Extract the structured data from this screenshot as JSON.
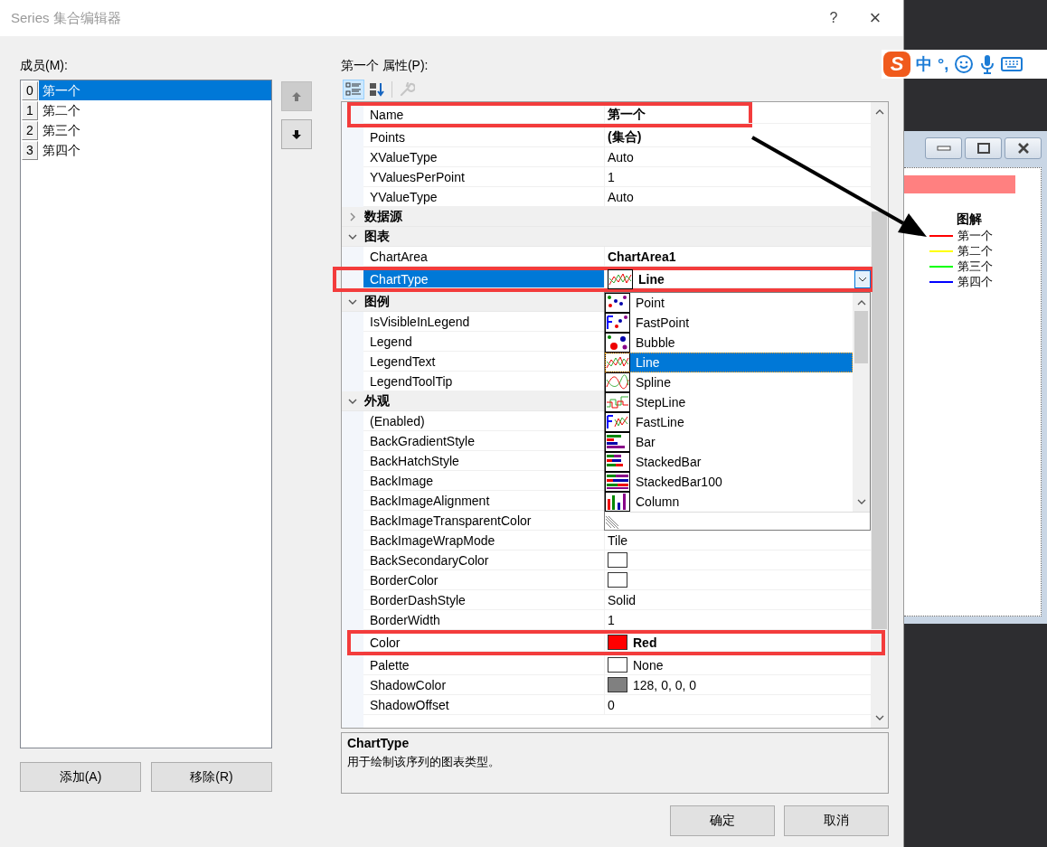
{
  "window": {
    "title": "Series 集合编辑器",
    "help": "?",
    "close": "×"
  },
  "members": {
    "label": "成员(M):",
    "items": [
      {
        "index": "0",
        "name": "第一个",
        "selected": true
      },
      {
        "index": "1",
        "name": "第二个",
        "selected": false
      },
      {
        "index": "2",
        "name": "第三个",
        "selected": false
      },
      {
        "index": "3",
        "name": "第四个",
        "selected": false
      }
    ]
  },
  "move_buttons": [
    {
      "kind": "up",
      "disabled": true
    },
    {
      "kind": "down",
      "disabled": false
    }
  ],
  "member_buttons": [
    "添加(A)",
    "移除(R)"
  ],
  "properties": {
    "label": "第一个 属性(P):",
    "view_buttons": [
      {
        "kind": "categorized",
        "selected": true
      },
      {
        "kind": "alphabetical",
        "selected": false
      }
    ],
    "pages_button": {
      "disabled": true
    },
    "rows": [
      {
        "kind": "property",
        "name": "Name",
        "value": "第一个",
        "modified": true,
        "selected": false,
        "annotated": true
      },
      {
        "kind": "property",
        "name": "Points",
        "value": "(集合)",
        "modified": true,
        "selected": false,
        "annotated": false
      },
      {
        "kind": "property",
        "name": "XValueType",
        "value": "Auto",
        "modified": false,
        "selected": false,
        "annotated": false
      },
      {
        "kind": "property",
        "name": "YValuesPerPoint",
        "value": "1",
        "modified": false,
        "selected": false,
        "annotated": false
      },
      {
        "kind": "property",
        "name": "YValueType",
        "value": "Auto",
        "modified": false,
        "selected": false,
        "annotated": false
      },
      {
        "kind": "category",
        "label": "数据源",
        "expanded": false
      },
      {
        "kind": "category",
        "label": "图表",
        "expanded": true
      },
      {
        "kind": "property",
        "name": "ChartArea",
        "value": "ChartArea1",
        "modified": true,
        "selected": false,
        "annotated": false
      },
      {
        "kind": "property",
        "name": "ChartType",
        "value": "Line",
        "modified": true,
        "selected": true,
        "annotated": true,
        "dropdown": {
          "items": [
            {
              "label": "Point",
              "kind": "point",
              "selected": false
            },
            {
              "label": "FastPoint",
              "kind": "fastpoint",
              "selected": false
            },
            {
              "label": "Bubble",
              "kind": "bubble",
              "selected": false
            },
            {
              "label": "Line",
              "kind": "line",
              "selected": true
            },
            {
              "label": "Spline",
              "kind": "spline",
              "selected": false
            },
            {
              "label": "StepLine",
              "kind": "stepline",
              "selected": false
            },
            {
              "label": "FastLine",
              "kind": "fastline",
              "selected": false
            },
            {
              "label": "Bar",
              "kind": "bar",
              "selected": false
            },
            {
              "label": "StackedBar",
              "kind": "stackedbar",
              "selected": false
            },
            {
              "label": "StackedBar100",
              "kind": "stackedbar100",
              "selected": false
            },
            {
              "label": "Column",
              "kind": "column",
              "selected": false
            }
          ]
        }
      },
      {
        "kind": "category",
        "label": "图例",
        "expanded": true
      },
      {
        "kind": "property",
        "name": "IsVisibleInLegend",
        "selected": false,
        "annotated": false
      },
      {
        "kind": "property",
        "name": "Legend",
        "selected": false,
        "annotated": false
      },
      {
        "kind": "property",
        "name": "LegendText",
        "selected": false,
        "annotated": false
      },
      {
        "kind": "property",
        "name": "LegendToolTip",
        "selected": false,
        "annotated": false
      },
      {
        "kind": "category",
        "label": "外观",
        "expanded": true
      },
      {
        "kind": "property",
        "name": "(Enabled)",
        "selected": false,
        "annotated": false
      },
      {
        "kind": "property",
        "name": "BackGradientStyle",
        "selected": false,
        "annotated": false
      },
      {
        "kind": "property",
        "name": "BackHatchStyle",
        "selected": false,
        "annotated": false
      },
      {
        "kind": "property",
        "name": "BackImage",
        "selected": false,
        "annotated": false
      },
      {
        "kind": "property",
        "name": "BackImageAlignment",
        "selected": false,
        "annotated": false
      },
      {
        "kind": "property",
        "name": "BackImageTransparentColor",
        "selected": false,
        "annotated": false
      },
      {
        "kind": "property",
        "name": "BackImageWrapMode",
        "value": "Tile",
        "modified": false,
        "selected": false,
        "annotated": false
      },
      {
        "kind": "property",
        "name": "BackSecondaryColor",
        "color": "#ffffff",
        "selected": false,
        "annotated": false
      },
      {
        "kind": "property",
        "name": "BorderColor",
        "color": "#ffffff",
        "selected": false,
        "annotated": false
      },
      {
        "kind": "property",
        "name": "BorderDashStyle",
        "value": "Solid",
        "modified": false,
        "selected": false,
        "annotated": false
      },
      {
        "kind": "property",
        "name": "BorderWidth",
        "value": "1",
        "modified": false,
        "selected": false,
        "annotated": false
      },
      {
        "kind": "property",
        "name": "Color",
        "color": "#ff0000",
        "value": "Red",
        "modified": true,
        "selected": false,
        "annotated": true
      },
      {
        "kind": "property",
        "name": "Palette",
        "color": "#ffffff",
        "value": "None",
        "modified": false,
        "selected": false,
        "annotated": false
      },
      {
        "kind": "property",
        "name": "ShadowColor",
        "color": "#808080",
        "value": "128, 0, 0, 0",
        "modified": false,
        "selected": false,
        "annotated": false
      },
      {
        "kind": "property",
        "name": "ShadowOffset",
        "value": "0",
        "modified": false,
        "selected": false,
        "annotated": false
      }
    ],
    "description": {
      "title": "ChartType",
      "text": "用于绘制该序列的图表类型。"
    }
  },
  "dialog_buttons": [
    "确定",
    "取消"
  ],
  "annotation_arrow": true,
  "ime_bar": {
    "logo": "S",
    "mode": "中",
    "punctuation": "°,"
  },
  "chart_window": {
    "legend": {
      "title": "图解",
      "items": [
        {
          "label": "第一个",
          "color": "#ff0000"
        },
        {
          "label": "第二个",
          "color": "#ffff00"
        },
        {
          "label": "第三个",
          "color": "#00ff00"
        },
        {
          "label": "第四个",
          "color": "#0000ff"
        }
      ]
    }
  }
}
